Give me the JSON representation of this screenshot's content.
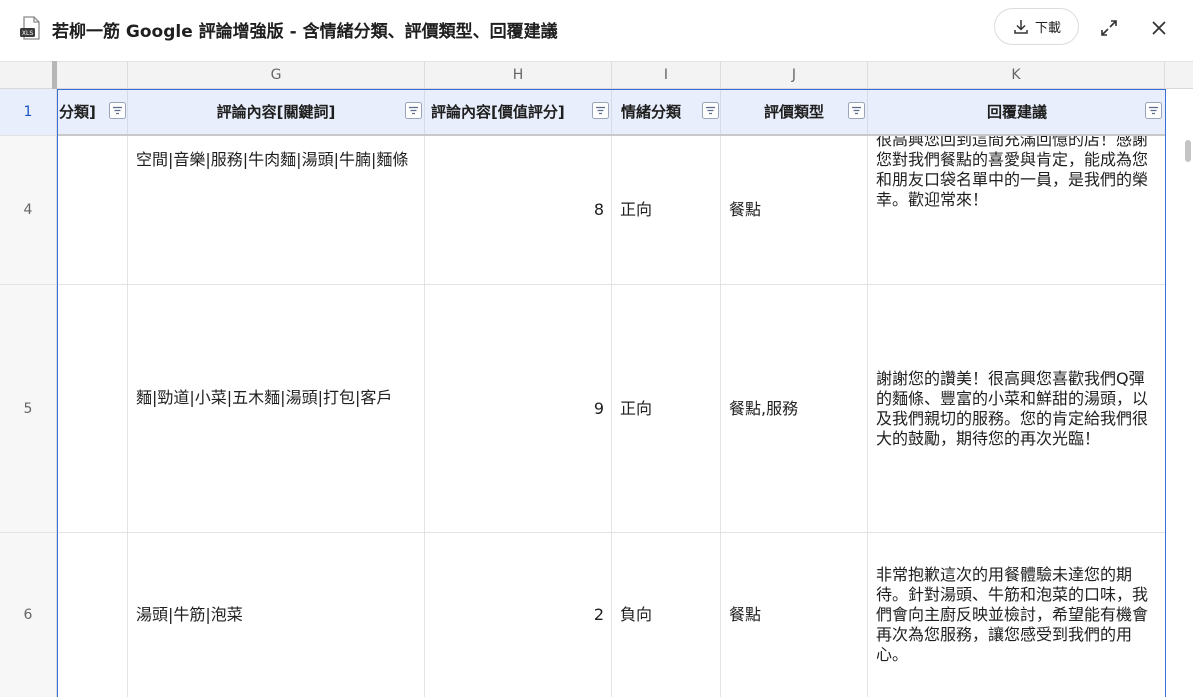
{
  "window": {
    "title": "若柳一筋 Google 評論增強版 - 含情緒分類、評價類型、回覆建議",
    "file_badge": "XLS",
    "download_label": "下載"
  },
  "columns": [
    "G",
    "H",
    "I",
    "J",
    "K"
  ],
  "header_row": {
    "row_number": "1",
    "cells": [
      "分類]",
      "評論內容[關鍵詞]",
      "評論內容[價值評分]",
      "情緒分類",
      "評價類型",
      "回覆建議"
    ]
  },
  "rows": [
    {
      "row_number": "4",
      "keywords": "空間|音樂|服務|牛肉麵|湯頭|牛腩|麵條",
      "score": "8",
      "sentiment": "正向",
      "type": "餐點",
      "reply": "很高興您回到這間充滿回憶的店！感謝您對我們餐點的喜愛與肯定，能成為您和朋友口袋名單中的一員，是我們的榮幸。歡迎常來！"
    },
    {
      "row_number": "5",
      "keywords": "麵|勁道|小菜|五木麵|湯頭|打包|客戶",
      "score": "9",
      "sentiment": "正向",
      "type": "餐點,服務",
      "reply": "謝謝您的讚美！很高興您喜歡我們Q彈的麵條、豐富的小菜和鮮甜的湯頭，以及我們親切的服務。您的肯定給我們很大的鼓勵，期待您的再次光臨！"
    },
    {
      "row_number": "6",
      "keywords": "湯頭|牛筋|泡菜",
      "score": "2",
      "sentiment": "負向",
      "type": "餐點",
      "reply": "非常抱歉這次的用餐體驗未達您的期待。針對湯頭、牛筋和泡菜的口味，我們會向主廚反映並檢討，希望能有機會再次為您服務，讓您感受到我們的用心。"
    }
  ],
  "colors": {
    "accent": "#3b6fd8",
    "header_bg": "#e8eefb"
  },
  "icons": [
    "xls-file-icon",
    "download-icon",
    "expand-icon",
    "close-icon",
    "filter-icon"
  ]
}
